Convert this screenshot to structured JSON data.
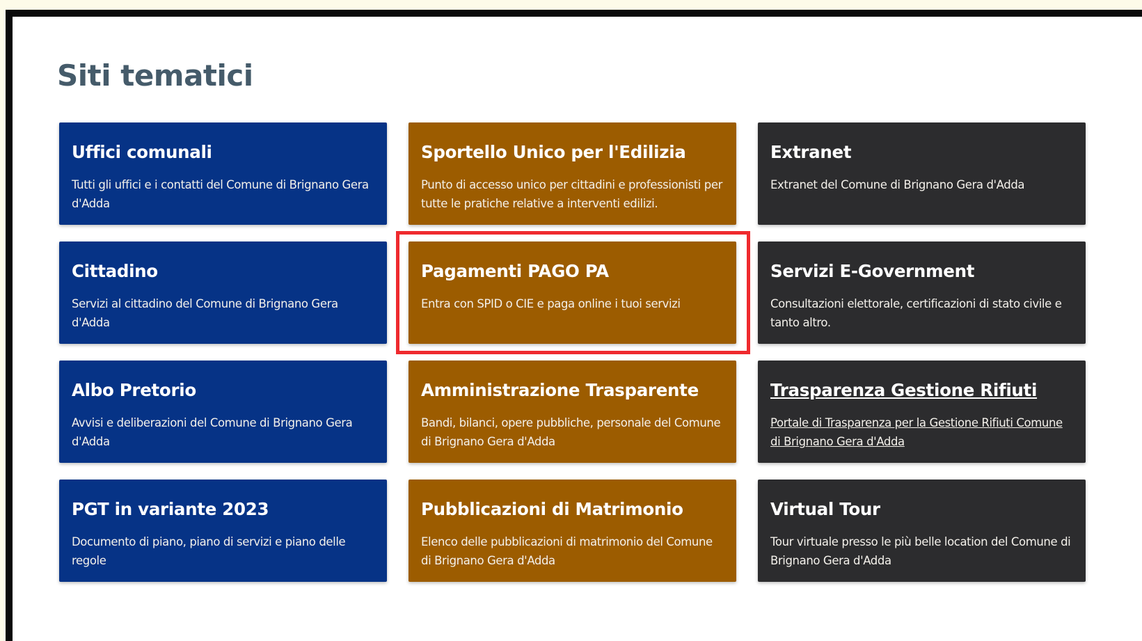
{
  "section": {
    "title": "Siti tematici"
  },
  "cards": [
    {
      "title": "Uffici comunali",
      "description": "Tutti gli uffici e i contatti del Comune di Brignano Gera d'Adda",
      "theme": "blue"
    },
    {
      "title": "Sportello Unico per l'Edilizia",
      "description": "Punto di accesso unico per cittadini e professionisti per tutte le pratiche relative a interventi edilizi.",
      "theme": "ochre"
    },
    {
      "title": "Extranet",
      "description": "Extranet del Comune di Brignano Gera d'Adda",
      "theme": "dark"
    },
    {
      "title": "Cittadino",
      "description": "Servizi al cittadino del Comune di Brignano Gera d'Adda",
      "theme": "blue"
    },
    {
      "title": "Pagamenti PAGO PA",
      "description": "Entra con SPID o CIE e paga online i tuoi servizi",
      "theme": "ochre"
    },
    {
      "title": "Servizi E-Government",
      "description": "Consultazioni elettorale, certificazioni di stato civile e tanto altro.",
      "theme": "dark"
    },
    {
      "title": "Albo Pretorio",
      "description": "Avvisi e deliberazioni del Comune di Brignano Gera d'Adda",
      "theme": "blue"
    },
    {
      "title": "Amministrazione Trasparente",
      "description": "Bandi, bilanci, opere pubbliche, personale del Comune di Brignano Gera d'Adda",
      "theme": "ochre"
    },
    {
      "title": "Trasparenza Gestione Rifiuti",
      "description": "Portale di Trasparenza per la Gestione Rifiuti Comune di Brignano Gera d'Adda",
      "theme": "dark"
    },
    {
      "title": "PGT in variante 2023",
      "description": "Documento di piano, piano di servizi e piano delle regole",
      "theme": "blue"
    },
    {
      "title": "Pubblicazioni di Matrimonio",
      "description": "Elenco delle pubblicazioni di matrimonio del Comune di Brignano Gera d'Adda",
      "theme": "ochre"
    },
    {
      "title": "Virtual Tour",
      "description": "Tour virtuale presso le più belle location del Comune di Brignano Gera d'Adda",
      "theme": "dark"
    }
  ],
  "colors": {
    "blue": "#063386",
    "ochre": "#9c5c00",
    "dark": "#2c2c2e",
    "highlight": "#ef2a2e",
    "title": "#455b6a"
  }
}
